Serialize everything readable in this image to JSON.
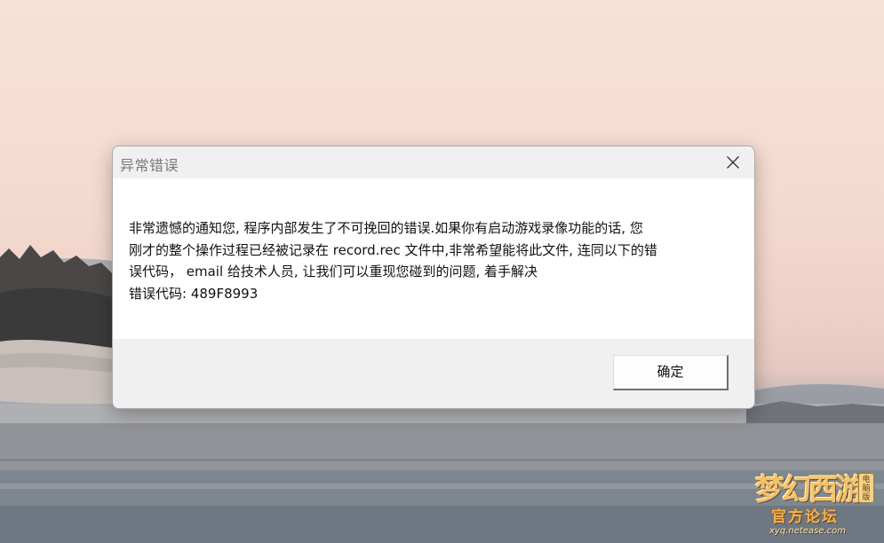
{
  "dialog": {
    "title": "异常错误",
    "message_lines": [
      "非常遗憾的通知您, 程序内部发生了不可挽回的错误.如果你有启动游戏录像功能的话, 您",
      "刚才的整个操作过程已经被记录在 record.rec 文件中,非常希望能将此文件, 连同以下的错",
      "误代码，  email 给技术人员, 让我们可以重现您碰到的问题, 着手解决",
      "错误代码: 489F8993"
    ],
    "ok_label": "确定",
    "close_icon": "close-icon"
  },
  "watermark": {
    "title": "梦幻西游",
    "subtitle": "官方论坛",
    "site": "xyq.netease.com",
    "badge": "电脑版"
  },
  "colors": {
    "dialog_bg": "#f0f0f0",
    "content_bg": "#ffffff",
    "title_text": "#7a7a7a",
    "message_text": "#111111"
  }
}
